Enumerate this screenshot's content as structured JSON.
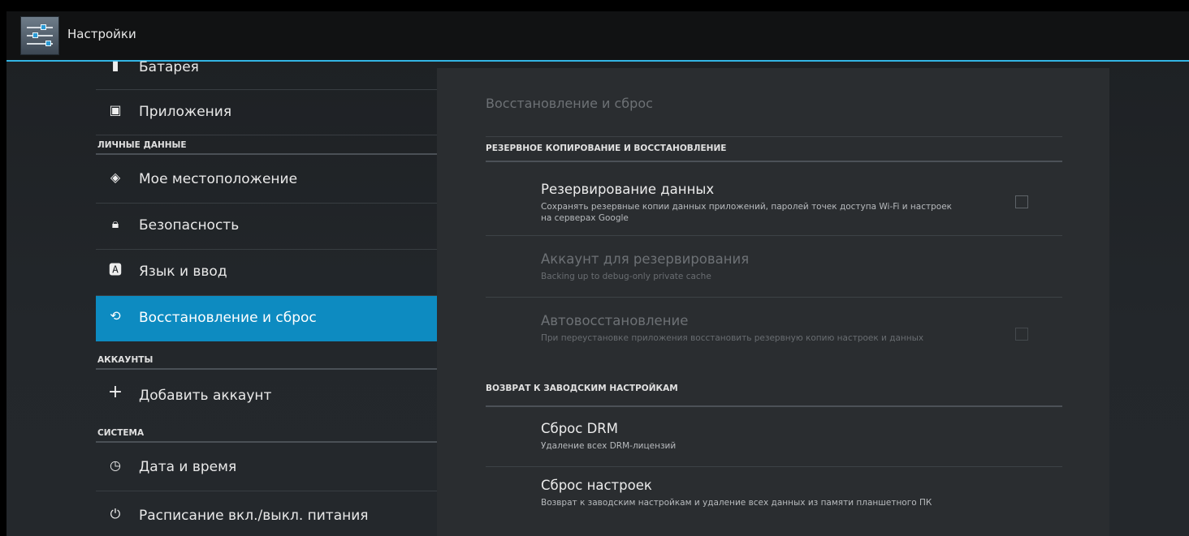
{
  "app": {
    "title": "Настройки",
    "icon": "settings-sliders-icon"
  },
  "sidebar": {
    "items": [
      {
        "label": "Батарея",
        "icon": "battery-icon"
      },
      {
        "label": "Приложения",
        "icon": "apps-icon"
      },
      {
        "header": "ЛИЧНЫЕ ДАННЫЕ"
      },
      {
        "label": "Мое местоположение",
        "icon": "location-icon"
      },
      {
        "label": "Безопасность",
        "icon": "lock-icon"
      },
      {
        "label": "Язык и ввод",
        "icon": "keyboard-icon"
      },
      {
        "label": "Восстановление и сброс",
        "icon": "restore-icon",
        "selected": true
      },
      {
        "header": "АККАУНТЫ"
      },
      {
        "label": "Добавить аккаунт",
        "icon": "plus-icon"
      },
      {
        "header": "СИСТЕМА"
      },
      {
        "label": "Дата и время",
        "icon": "clock-icon"
      },
      {
        "label": "Расписание вкл./выкл. питания",
        "icon": "power-schedule-icon"
      }
    ]
  },
  "panel": {
    "title": "Восстановление и сброс",
    "sections": [
      {
        "header": "РЕЗЕРВНОЕ КОПИРОВАНИЕ И ВОССТАНОВЛЕНИЕ",
        "prefs": [
          {
            "title": "Резервирование данных",
            "summary": "Сохранять резервные копии данных приложений, паролей точек доступа Wi-Fi и настроек на серверах Google",
            "checkbox": true,
            "checked": false,
            "enabled": true
          },
          {
            "title": "Аккаунт для резервирования",
            "summary": "Backing up to debug-only private cache",
            "checkbox": false,
            "enabled": false
          },
          {
            "title": "Автовосстановление",
            "summary": "При переустановке приложения восстановить резервную копию настроек и данных",
            "checkbox": true,
            "checked": false,
            "enabled": false
          }
        ]
      },
      {
        "header": "ВОЗВРАТ К ЗАВОДСКИМ НАСТРОЙКАМ",
        "prefs": [
          {
            "title": "Сброс DRM",
            "summary": "Удаление всех DRM-лицензий",
            "enabled": true
          },
          {
            "title": "Сброс настроек",
            "summary": "Возврат к заводским настройкам и удаление всех данных из памяти планшетного ПК",
            "enabled": true
          }
        ]
      }
    ]
  },
  "colors": {
    "accent": "#33b5e5",
    "selected": "#0d8bc1",
    "background": "#212529",
    "panel": "#2a2d30"
  }
}
